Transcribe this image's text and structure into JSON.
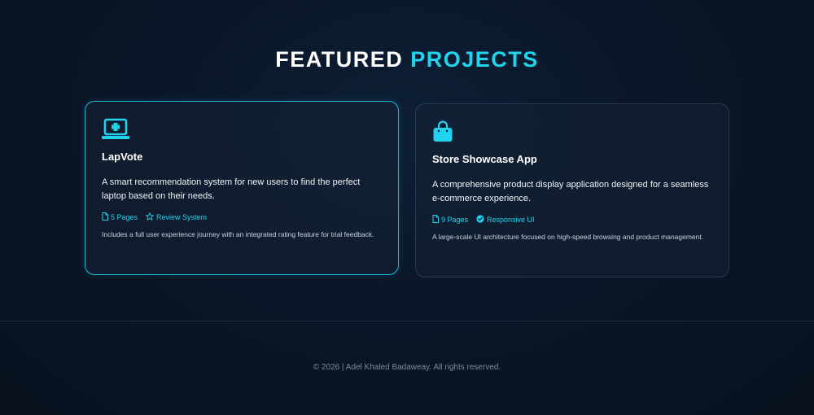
{
  "heading": {
    "word1": "FEATURED",
    "word2": "PROJECTS"
  },
  "colors": {
    "accent": "#22d3ee",
    "background": "#0a1628"
  },
  "projects": [
    {
      "icon": "laptop-medical-icon",
      "title": "LapVote",
      "description": "A smart recommendation system for new users to find the perfect laptop based on their needs.",
      "tags": [
        {
          "icon": "file-icon",
          "label": "5 Pages"
        },
        {
          "icon": "star-icon",
          "label": "Review System"
        }
      ],
      "note": "Includes a full user experience journey with an integrated rating feature for trial feedback."
    },
    {
      "icon": "shopping-bag-icon",
      "title": "Store Showcase App",
      "description": "A comprehensive product display application designed for a seamless e-commerce experience.",
      "tags": [
        {
          "icon": "file-icon",
          "label": "9 Pages"
        },
        {
          "icon": "check-circle-icon",
          "label": "Responsive UI"
        }
      ],
      "note": "A large-scale UI architecture focused on high-speed browsing and product management."
    }
  ],
  "footer": {
    "text": "© 2026 | Adel Khaled Badaweay. All rights reserved."
  }
}
